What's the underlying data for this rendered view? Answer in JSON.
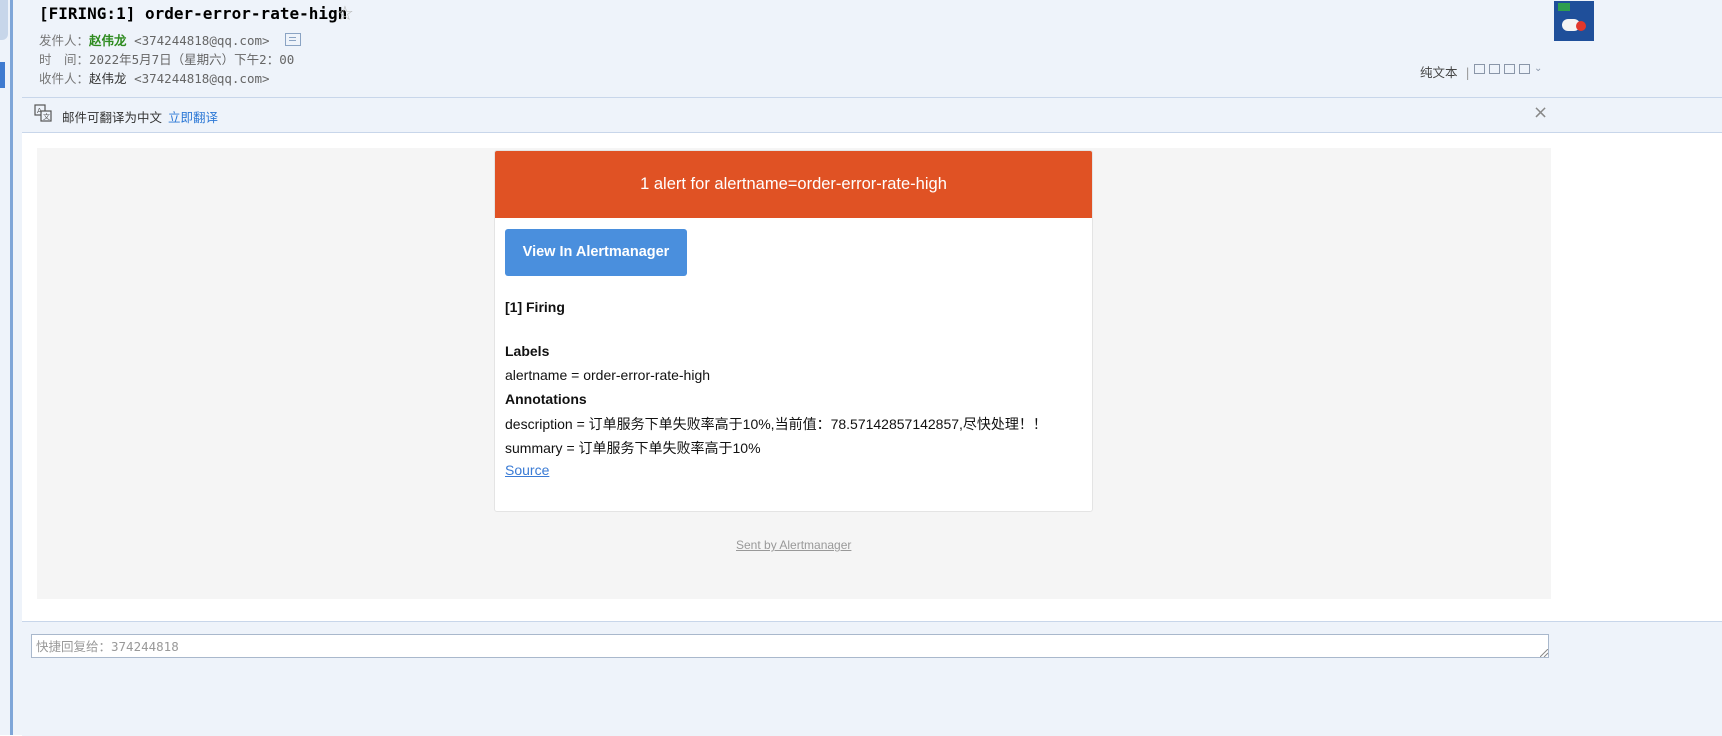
{
  "email": {
    "subject": "[FIRING:1] order-error-rate-high",
    "sender_label": "发件人：",
    "sender_name": "赵伟龙",
    "sender_email": "<374244818@qq.com>",
    "time_label": "时　间：",
    "time_value": "2022年5月7日（星期六）下午2：00",
    "recipient_label": "收件人：",
    "recipient_name": "赵伟龙",
    "recipient_email": "<374244818@qq.com>",
    "plaintext_label": "纯文本",
    "separator": "|"
  },
  "translate": {
    "text": "邮件可翻译为中文",
    "link": "立即翻译",
    "close": "×"
  },
  "alert": {
    "header": "1 alert for alertname=order-error-rate-high",
    "button": "View In Alertmanager",
    "firing": "[1] Firing",
    "labels_heading": "Labels",
    "label_line": "alertname = order-error-rate-high",
    "annotations_heading": "Annotations",
    "description": "description = 订单服务下单失败率高于10%,当前值：78.57142857142857,尽快处理！！",
    "summary": "summary = 订单服务下单失败率高于10%",
    "source": "Source",
    "sent_by": "Sent by Alertmanager"
  },
  "reply": {
    "placeholder": "快捷回复给：374244818"
  },
  "icons": [
    "star-icon",
    "vcard-icon",
    "avatar",
    "translate-icon",
    "close-icon",
    "window-icon",
    "print-icon",
    "chevron-down-icon"
  ]
}
